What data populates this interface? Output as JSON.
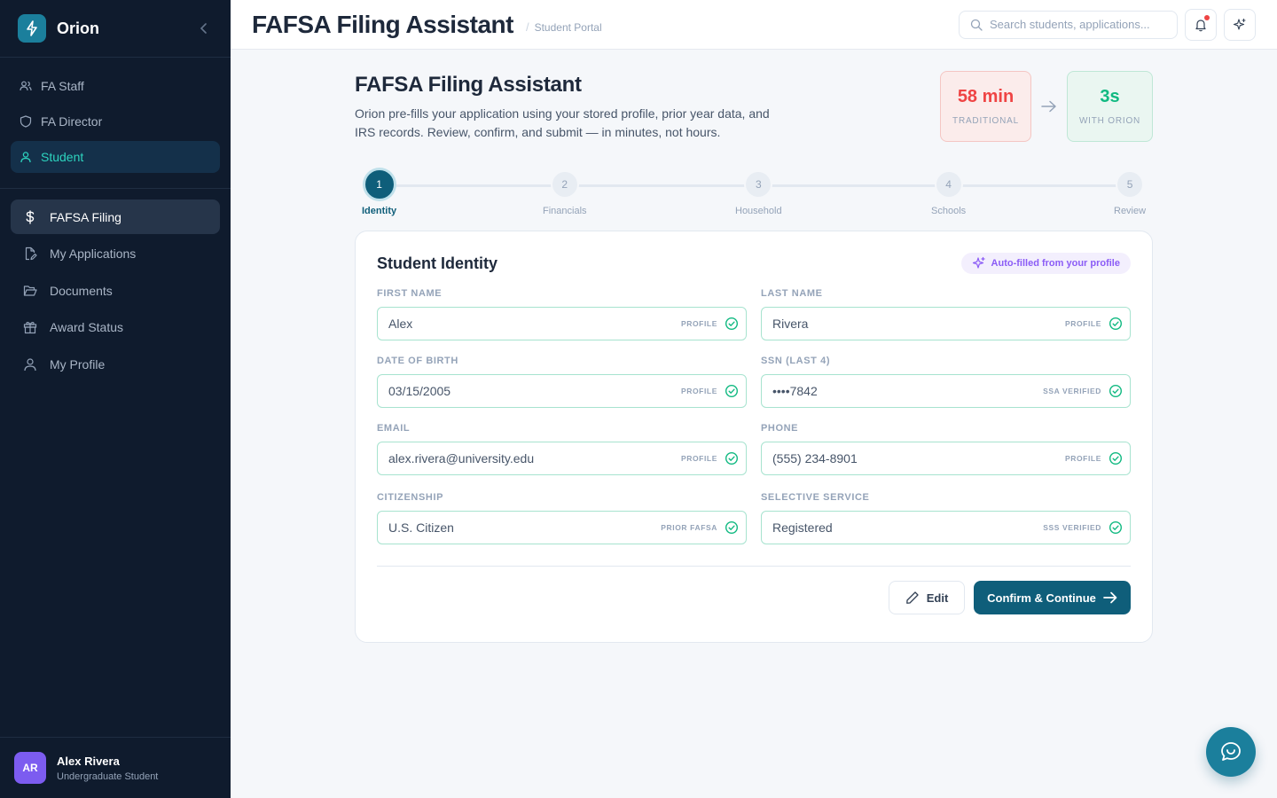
{
  "app": {
    "name": "Orion"
  },
  "sidebar": {
    "roles": [
      {
        "label": "FA Staff",
        "icon": "users-icon"
      },
      {
        "label": "FA Director",
        "icon": "shield-icon"
      },
      {
        "label": "Student",
        "icon": "user-icon",
        "active": true
      }
    ],
    "nav": [
      {
        "label": "FAFSA Filing",
        "icon": "dollar-icon",
        "active": true
      },
      {
        "label": "My Applications",
        "icon": "file-edit-icon"
      },
      {
        "label": "Documents",
        "icon": "folder-open-icon"
      },
      {
        "label": "Award Status",
        "icon": "gift-icon"
      },
      {
        "label": "My Profile",
        "icon": "user-icon"
      }
    ],
    "user": {
      "initials": "AR",
      "name": "Alex Rivera",
      "role": "Undergraduate Student"
    }
  },
  "topbar": {
    "title": "FAFSA Filing Assistant",
    "separator": "/",
    "breadcrumb": "Student Portal",
    "search_placeholder": "Search students, applications..."
  },
  "header": {
    "title": "FAFSA Filing Assistant",
    "description": "Orion pre-fills your application using your stored profile, prior year data, and IRS records. Review, confirm, and submit — in minutes, not hours.",
    "traditional": {
      "value": "58 min",
      "label": "TRADITIONAL"
    },
    "orion": {
      "value": "3s",
      "label": "WITH ORION"
    }
  },
  "steps": [
    {
      "number": "1",
      "label": "Identity",
      "active": true
    },
    {
      "number": "2",
      "label": "Financials"
    },
    {
      "number": "3",
      "label": "Household"
    },
    {
      "number": "4",
      "label": "Schools"
    },
    {
      "number": "5",
      "label": "Review"
    }
  ],
  "card": {
    "title": "Student Identity",
    "autofill_badge": "Auto-filled from your profile",
    "fields": [
      {
        "label": "FIRST NAME",
        "value": "Alex",
        "source": "PROFILE"
      },
      {
        "label": "LAST NAME",
        "value": "Rivera",
        "source": "PROFILE"
      },
      {
        "label": "DATE OF BIRTH",
        "value": "03/15/2005",
        "source": "PROFILE"
      },
      {
        "label": "SSN (LAST 4)",
        "value": "••••7842",
        "source": "SSA VERIFIED"
      },
      {
        "label": "EMAIL",
        "value": "alex.rivera@university.edu",
        "source": "PROFILE"
      },
      {
        "label": "PHONE",
        "value": "(555) 234-8901",
        "source": "PROFILE"
      },
      {
        "label": "CITIZENSHIP",
        "value": "U.S. Citizen",
        "source": "PRIOR FAFSA"
      },
      {
        "label": "SELECTIVE SERVICE",
        "value": "Registered",
        "source": "SSS VERIFIED"
      }
    ],
    "edit_label": "Edit",
    "confirm_label": "Confirm & Continue"
  },
  "colors": {
    "accent": "#0f5e7a",
    "brand": "#1b7f9c",
    "sidebar_bg": "#0f1b2d",
    "success": "#10b981",
    "danger": "#ef4444",
    "purple": "#8b5cf6"
  }
}
